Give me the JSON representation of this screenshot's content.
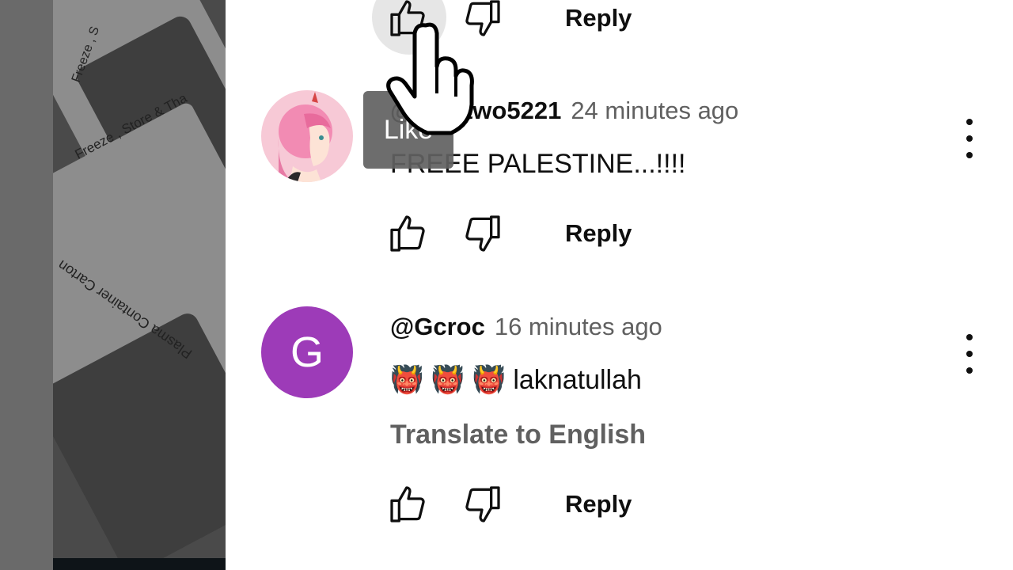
{
  "backdrop": {
    "label_1": "Freeze , Store & Tha",
    "label_2": "Plasma Container Carton",
    "label_3": "Freeze , S"
  },
  "comments": [
    {
      "reply_label": "Reply"
    },
    {
      "handle": "@zerotwo5221",
      "time": "24 minutes ago",
      "text": "FREEE PALESTINE...!!!!",
      "reply_label": "Reply"
    },
    {
      "handle": "@Gcroc",
      "avatar_letter": "G",
      "time": "16 minutes ago",
      "text": "👹 👹 👹 laknatullah",
      "translate_label": "Translate to English",
      "reply_label": "Reply"
    }
  ],
  "tooltip": {
    "label": "Like"
  },
  "colors": {
    "avatar_g": "#9d3bb8",
    "secondary_text": "#606060",
    "tooltip_bg": "#616161"
  }
}
